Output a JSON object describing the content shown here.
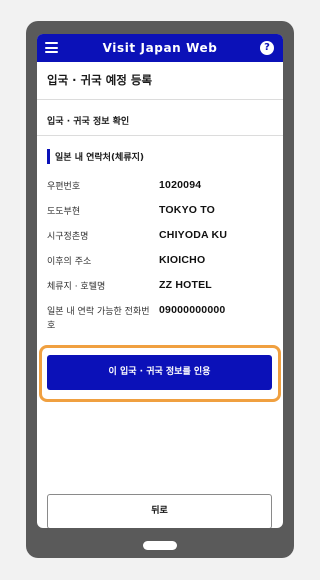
{
  "header": {
    "title": "Visit Japan Web",
    "menu_icon": "hamburger-menu-icon",
    "help_icon": "question-icon",
    "help_glyph": "?",
    "bar_color": "#0b11b8"
  },
  "page": {
    "title": "입국 · 귀국 예정 등록",
    "section_title": "입국 · 귀국 정보 확인",
    "subheading": "일본 내 연락처(체류지)"
  },
  "fields": [
    {
      "label": "우편번호",
      "value": "1020094"
    },
    {
      "label": "도도부현",
      "value": "TOKYO TO"
    },
    {
      "label": "시구정촌명",
      "value": "CHIYODA KU"
    },
    {
      "label": "이후의 주소",
      "value": "KIOICHO"
    },
    {
      "label": "체류지 · 호텔명",
      "value": "ZZ HOTEL"
    },
    {
      "label": "일본 내 연락 가능한 전화번호",
      "value": "09000000000"
    }
  ],
  "actions": {
    "cite_button": "이 입국 · 귀국 정보를 인용",
    "back_button": "뒤로"
  },
  "colors": {
    "primary": "#0b11b8",
    "highlight": "#f0a040",
    "device_frame": "#5a5a5a"
  }
}
